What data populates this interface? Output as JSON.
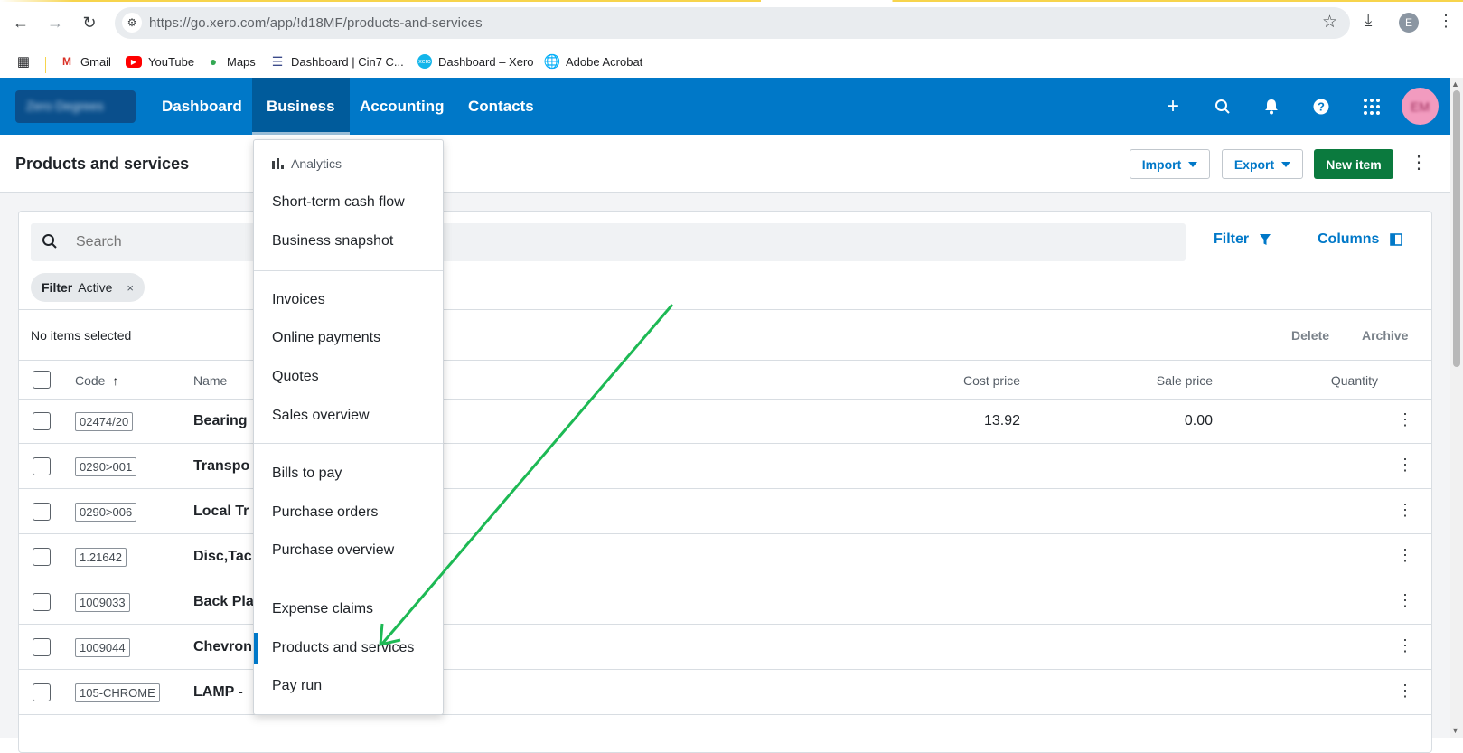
{
  "browser": {
    "url": "https://go.xero.com/app/!d18MF/products-and-services",
    "profile_initial": "E",
    "bookmarks": [
      {
        "label": "Gmail",
        "icon": "gmail-icon"
      },
      {
        "label": "YouTube",
        "icon": "youtube-icon"
      },
      {
        "label": "Maps",
        "icon": "maps-icon"
      },
      {
        "label": "Dashboard | Cin7 C...",
        "icon": "cin7-icon"
      },
      {
        "label": "Dashboard – Xero",
        "icon": "xero-icon"
      },
      {
        "label": "Adobe Acrobat",
        "icon": "globe-icon"
      }
    ]
  },
  "xero_nav": {
    "org_name": "Zero Degrees",
    "links": [
      "Dashboard",
      "Business",
      "Accounting",
      "Contacts"
    ],
    "active_link": "Business",
    "avatar_initials": "EM",
    "colors": {
      "nav_bg": "#0078c8",
      "active_bg": "#005b9b",
      "primary_button": "#0b7a3e"
    }
  },
  "page": {
    "title": "Products and services",
    "import_label": "Import",
    "export_label": "Export",
    "new_item_label": "New item"
  },
  "toolbar": {
    "search_placeholder": "Search",
    "filter_label": "Filter",
    "columns_label": "Columns",
    "chip_key": "Filter",
    "chip_value": "Active",
    "chip_close": "×"
  },
  "selection": {
    "status": "No items selected",
    "delete_label": "Delete",
    "archive_label": "Archive"
  },
  "table": {
    "headers": {
      "code": "Code",
      "name": "Name",
      "cost": "Cost price",
      "sale": "Sale price",
      "quantity": "Quantity"
    },
    "rows": [
      {
        "code": "02474/20",
        "name": "Bearing",
        "cost": "13.92",
        "sale": "0.00"
      },
      {
        "code": "0290>001",
        "name": "Transpo",
        "cost": "",
        "sale": ""
      },
      {
        "code": "0290>006",
        "name": "Local Tr",
        "cost": "",
        "sale": ""
      },
      {
        "code": "1.21642",
        "name": "Disc,Tac",
        "cost": "",
        "sale": ""
      },
      {
        "code": "1009033",
        "name": "Back Pla",
        "cost": "",
        "sale": ""
      },
      {
        "code": "1009044",
        "name": "Chevron",
        "cost": "",
        "sale": ""
      },
      {
        "code": "105-CHROME",
        "name": "LAMP -",
        "cost": "",
        "sale": ""
      }
    ]
  },
  "business_menu": {
    "analytics_label": "Analytics",
    "groups": [
      [
        "Short-term cash flow",
        "Business snapshot"
      ],
      [
        "Invoices",
        "Online payments",
        "Quotes",
        "Sales overview"
      ],
      [
        "Bills to pay",
        "Purchase orders",
        "Purchase overview"
      ],
      [
        "Expense claims",
        "Products and services",
        "Pay run"
      ]
    ],
    "current_item": "Products and services"
  },
  "annotation": {
    "arrow_color": "#1db954"
  }
}
